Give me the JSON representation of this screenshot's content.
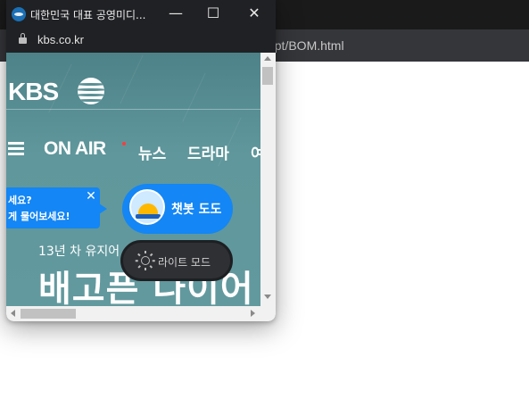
{
  "background_window": {
    "url_fragment": "ript/BOM.html"
  },
  "popup": {
    "title": "대한민국 대표 공영미디...",
    "url": "kbs.co.kr",
    "controls": {
      "minimize": "—",
      "maximize": "☐",
      "close": "✕"
    }
  },
  "site": {
    "logo": "KBS",
    "nav": {
      "onair": "ON AIR",
      "items": [
        "뉴스",
        "드라마",
        "여"
      ]
    },
    "chat_bubble": {
      "line1": "세요?",
      "line2": "게 물어보세요!",
      "close": "✕"
    },
    "chatbot_label": "챗봇 도도",
    "promo": {
      "subtitle": "13년 차 유지어",
      "title": "배고픈 나이어"
    },
    "lightmode_label": "라이트 모드"
  },
  "colors": {
    "content_bg": "#5f9499",
    "accent_blue": "#1486f5",
    "chrome_dark": "#202124"
  }
}
